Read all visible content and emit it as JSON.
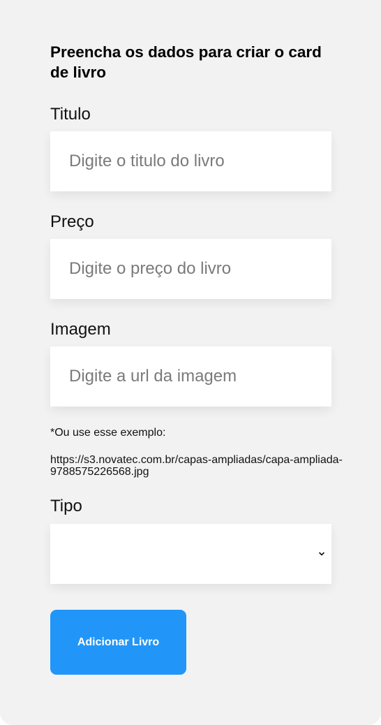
{
  "form": {
    "title": "Preencha os dados para criar o card de livro",
    "title_field": {
      "label": "Titulo",
      "placeholder": "Digite o titulo do livro",
      "value": ""
    },
    "price_field": {
      "label": "Preço",
      "placeholder": "Digite o preço do livro",
      "value": ""
    },
    "image_field": {
      "label": "Imagem",
      "placeholder": "Digite a url da imagem",
      "value": ""
    },
    "example_hint": "*Ou use esse exemplo:",
    "example_url": "https://s3.novatec.com.br/capas-ampliadas/capa-ampliada-9788575226568.jpg",
    "type_field": {
      "label": "Tipo",
      "selected": "",
      "chevron_icon": "chevron-down-icon"
    },
    "submit_label": "Adicionar Livro"
  },
  "colors": {
    "card_background": "#f2f2f2",
    "input_background": "#ffffff",
    "button_background": "#2196f8",
    "button_text": "#ffffff"
  }
}
